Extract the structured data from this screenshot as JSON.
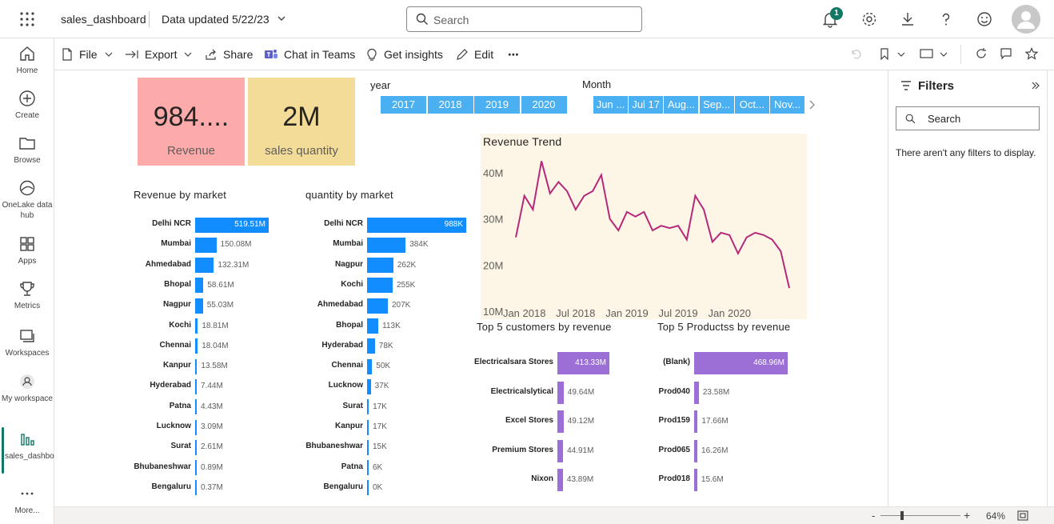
{
  "header": {
    "app_title": "sales_dashboard",
    "data_updated": "Data updated 5/22/23",
    "search_placeholder": "Search",
    "notification_count": "1"
  },
  "leftnav": {
    "items": [
      {
        "label": "Home",
        "icon": "home-icon"
      },
      {
        "label": "Create",
        "icon": "plus-circle-icon"
      },
      {
        "label": "Browse",
        "icon": "folder-icon"
      },
      {
        "label": "OneLake data hub",
        "icon": "onelake-icon"
      },
      {
        "label": "Apps",
        "icon": "apps-icon"
      },
      {
        "label": "Metrics",
        "icon": "trophy-icon"
      },
      {
        "label": "Workspaces",
        "icon": "workspaces-icon"
      },
      {
        "label": "My workspace",
        "icon": "my-workspace-icon"
      },
      {
        "label": "sales_dashboard",
        "icon": "report-icon"
      },
      {
        "label": "More...",
        "icon": "more-icon"
      }
    ]
  },
  "toolbar": {
    "file": "File",
    "export": "Export",
    "share": "Share",
    "chat": "Chat in Teams",
    "insights": "Get insights",
    "edit": "Edit",
    "more": "⋯"
  },
  "kpis": [
    {
      "value": "984....",
      "label": "Revenue",
      "color": "#fdaaaa"
    },
    {
      "value": "2M",
      "label": "sales quantity",
      "color": "#f2dc98"
    }
  ],
  "slicers": {
    "year_title": "year",
    "years": [
      "2017",
      "2018",
      "2019",
      "2020"
    ],
    "month_title": "Month",
    "months": [
      "Jun ...",
      "Jul 17",
      "Aug...",
      "Sep...",
      "Oct...",
      "Nov..."
    ]
  },
  "colors": {
    "blue_bar": "#118dff",
    "purple_bar": "#9b6fd6",
    "slicer": "#4ab0f2",
    "trend_line": "#b5297a",
    "trend_bg": "#fdf5e6",
    "accent": "#117865"
  },
  "chart_data": [
    {
      "type": "bar",
      "title": "Revenue by market",
      "orientation": "horizontal",
      "categories": [
        "Delhi NCR",
        "Mumbai",
        "Ahmedabad",
        "Bhopal",
        "Nagpur",
        "Kochi",
        "Chennai",
        "Kanpur",
        "Hyderabad",
        "Patna",
        "Lucknow",
        "Surat",
        "Bhubaneshwar",
        "Bengaluru"
      ],
      "values": [
        519.51,
        150.08,
        132.31,
        58.61,
        55.03,
        18.81,
        18.04,
        13.58,
        7.44,
        4.43,
        3.09,
        2.61,
        0.89,
        0.37
      ],
      "labels": [
        "519.51M",
        "150.08M",
        "132.31M",
        "58.61M",
        "55.03M",
        "18.81M",
        "18.04M",
        "13.58M",
        "7.44M",
        "4.43M",
        "3.09M",
        "2.61M",
        "0.89M",
        "0.37M"
      ]
    },
    {
      "type": "bar",
      "title": "quantity by market",
      "orientation": "horizontal",
      "categories": [
        "Delhi NCR",
        "Mumbai",
        "Nagpur",
        "Kochi",
        "Ahmedabad",
        "Bhopal",
        "Hyderabad",
        "Chennai",
        "Lucknow",
        "Surat",
        "Kanpur",
        "Bhubaneshwar",
        "Patna",
        "Bengaluru"
      ],
      "values": [
        988,
        384,
        262,
        255,
        207,
        113,
        78,
        50,
        37,
        17,
        17,
        15,
        6,
        0
      ],
      "labels": [
        "988K",
        "384K",
        "262K",
        "255K",
        "207K",
        "113K",
        "78K",
        "50K",
        "37K",
        "17K",
        "17K",
        "15K",
        "6K",
        "0K"
      ]
    },
    {
      "type": "line",
      "title": "Revenue Trend",
      "x_tick_labels": [
        "Jan 2018",
        "Jul 2018",
        "Jan 2019",
        "Jul 2019",
        "Jan 2020"
      ],
      "y_tick_labels": [
        "40M",
        "30M",
        "20M",
        "10M"
      ],
      "ylim": [
        10,
        45
      ],
      "values": [
        26,
        35,
        32,
        42.5,
        35.5,
        38,
        36,
        32,
        35,
        36,
        39.5,
        30,
        27.5,
        31.5,
        30.5,
        31.5,
        27.5,
        28.5,
        28,
        28.5,
        25.5,
        35,
        32,
        25,
        27,
        26.5,
        22.5,
        26,
        27,
        26.5,
        25.5,
        23,
        15
      ]
    },
    {
      "type": "bar",
      "title": "Top 5 customers by revenue",
      "orientation": "horizontal",
      "categories": [
        "Electricalsara Stores",
        "Electricalslytical",
        "Excel Stores",
        "Premium Stores",
        "Nixon"
      ],
      "values": [
        413.33,
        49.64,
        49.12,
        44.91,
        43.89
      ],
      "labels": [
        "413.33M",
        "49.64M",
        "49.12M",
        "44.91M",
        "43.89M"
      ]
    },
    {
      "type": "bar",
      "title": "Top 5 Productss by revenue",
      "orientation": "horizontal",
      "categories": [
        "(Blank)",
        "Prod040",
        "Prod159",
        "Prod065",
        "Prod018"
      ],
      "values": [
        468.96,
        23.58,
        17.66,
        16.26,
        15.6
      ],
      "labels": [
        "468.96M",
        "23.58M",
        "17.66M",
        "16.26M",
        "15.6M"
      ]
    }
  ],
  "filters": {
    "title": "Filters",
    "search_placeholder": "Search",
    "empty_text": "There aren't any filters to display."
  },
  "status": {
    "zoom": "64%"
  }
}
